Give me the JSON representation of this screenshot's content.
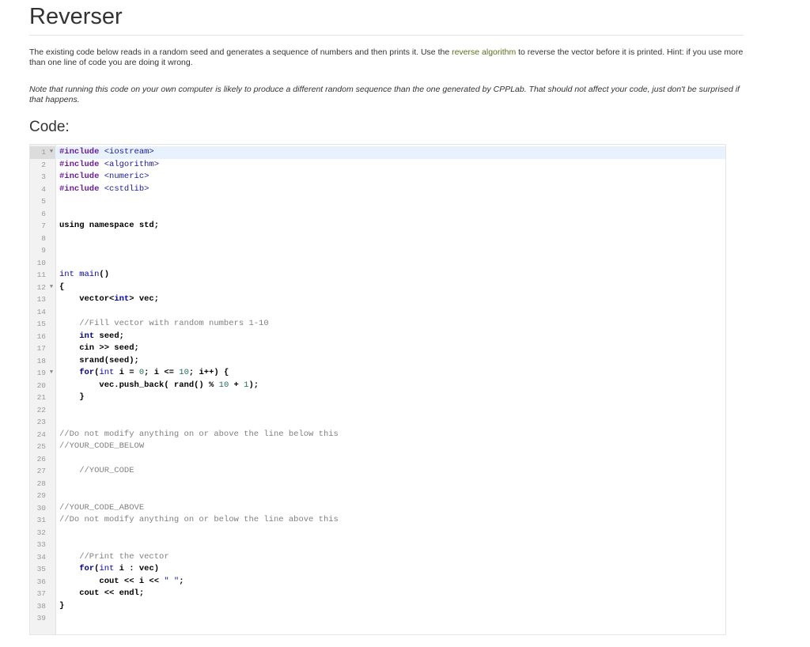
{
  "page": {
    "title": "Reverser",
    "paragraph1_before_link": "The existing code below reads in a random seed and generates a sequence of numbers and then prints it. Use the ",
    "paragraph1_link": "reverse algorithm",
    "paragraph1_after_link": " to reverse the vector before it is printed. Hint: if you use more than one line of code you are doing it wrong.",
    "paragraph2": "Note that running this code on your own computer is likely to produce a different random sequence than the one generated by CPPLab. That should not affect your code, just don't be surprised if that happens.",
    "code_heading": "Code:"
  },
  "editor": {
    "lines": [
      {
        "n": "1",
        "fold": true
      },
      {
        "n": "2"
      },
      {
        "n": "3"
      },
      {
        "n": "4"
      },
      {
        "n": "5"
      },
      {
        "n": "6"
      },
      {
        "n": "7"
      },
      {
        "n": "8"
      },
      {
        "n": "9"
      },
      {
        "n": "10"
      },
      {
        "n": "11"
      },
      {
        "n": "12",
        "fold": true
      },
      {
        "n": "13"
      },
      {
        "n": "14"
      },
      {
        "n": "15"
      },
      {
        "n": "16"
      },
      {
        "n": "17"
      },
      {
        "n": "18"
      },
      {
        "n": "19",
        "fold": true
      },
      {
        "n": "20"
      },
      {
        "n": "21"
      },
      {
        "n": "22"
      },
      {
        "n": "23"
      },
      {
        "n": "24"
      },
      {
        "n": "25"
      },
      {
        "n": "26"
      },
      {
        "n": "27"
      },
      {
        "n": "28"
      },
      {
        "n": "29"
      },
      {
        "n": "30"
      },
      {
        "n": "31"
      },
      {
        "n": "32"
      },
      {
        "n": "33"
      },
      {
        "n": "34"
      },
      {
        "n": "35"
      },
      {
        "n": "36"
      },
      {
        "n": "37"
      },
      {
        "n": "38"
      },
      {
        "n": "39"
      }
    ],
    "tokens": {
      "l1_a": "#include ",
      "l1_b": "<iostream>",
      "l2_a": "#include ",
      "l2_b": "<algorithm>",
      "l3_a": "#include ",
      "l3_b": "<numeric>",
      "l4_a": "#include ",
      "l4_b": "<cstdlib>",
      "l7": "using namespace std;",
      "l11_a": "int",
      "l11_b": " main",
      "l11_c": "()",
      "l12": "{",
      "l13_a": "    vector<",
      "l13_b": "int",
      "l13_c": "> vec;",
      "l15": "    //Fill vector with random numbers 1-10",
      "l16_a": "    ",
      "l16_b": "int",
      "l16_c": " seed;",
      "l17": "    cin >> seed;",
      "l18": "    srand(seed);",
      "l19_a": "    ",
      "l19_b": "for",
      "l19_c": "(",
      "l19_d": "int",
      "l19_e": " i = ",
      "l19_f": "0",
      "l19_g": "; i <= ",
      "l19_h": "10",
      "l19_i": "; i++) {",
      "l20_a": "        vec.push_back( rand() % ",
      "l20_b": "10",
      "l20_c": " + ",
      "l20_d": "1",
      "l20_e": ");",
      "l21": "    }",
      "l24": "//Do not modify anything on or above the line below this",
      "l25": "//YOUR_CODE_BELOW",
      "l27": "    //YOUR_CODE",
      "l30": "//YOUR_CODE_ABOVE",
      "l31": "//Do not modify anything on or below the line above this",
      "l34": "    //Print the vector",
      "l35_a": "    ",
      "l35_b": "for",
      "l35_c": "(",
      "l35_d": "int",
      "l35_e": " i : vec)",
      "l36_a": "        cout << i << ",
      "l36_b": "\" \"",
      "l36_c": ";",
      "l37": "    cout << endl;",
      "l38": "}"
    }
  }
}
